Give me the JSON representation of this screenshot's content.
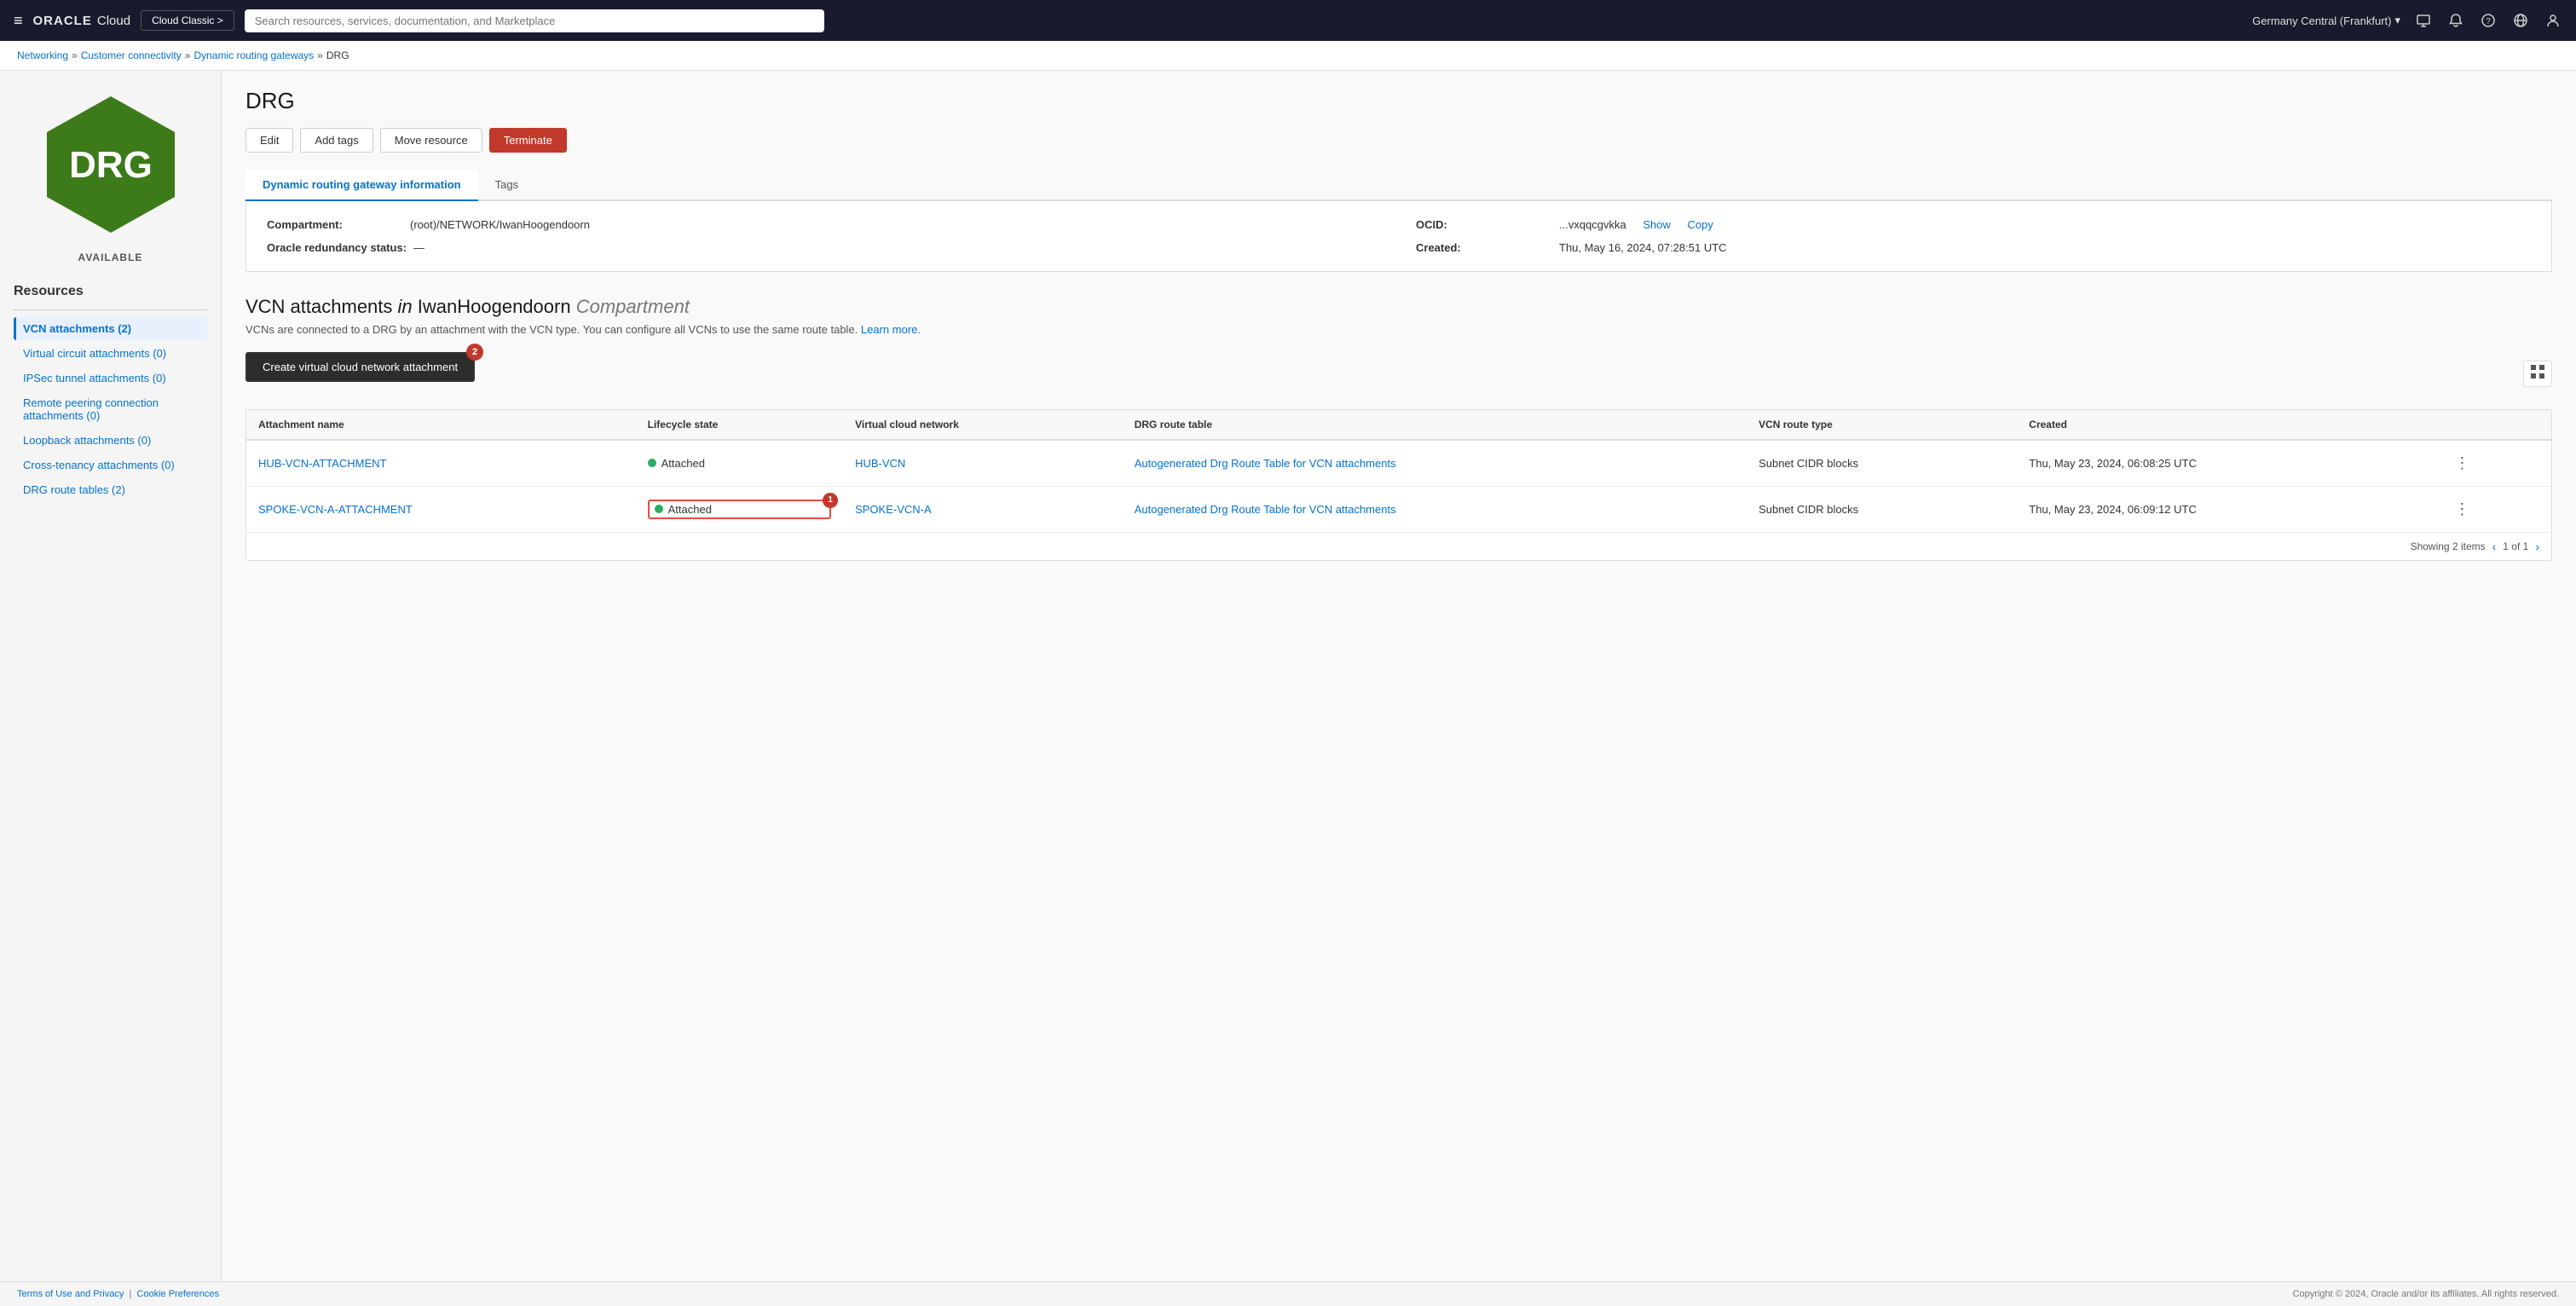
{
  "nav": {
    "hamburger_icon": "≡",
    "brand_oracle": "ORACLE",
    "brand_cloud": "Cloud",
    "classic_btn": "Cloud Classic >",
    "search_placeholder": "Search resources, services, documentation, and Marketplace",
    "region": "Germany Central (Frankfurt)",
    "chevron_down": "▾"
  },
  "breadcrumb": {
    "networking": "Networking",
    "customer_connectivity": "Customer connectivity",
    "dynamic_routing_gateways": "Dynamic routing gateways",
    "current": "DRG"
  },
  "left_panel": {
    "drg_text": "DRG",
    "status_label": "AVAILABLE",
    "resources_heading": "Resources",
    "sidebar_items": [
      {
        "label": "VCN attachments (2)",
        "active": true
      },
      {
        "label": "Virtual circuit attachments (0)",
        "active": false
      },
      {
        "label": "IPSec tunnel attachments (0)",
        "active": false
      },
      {
        "label": "Remote peering connection attachments (0)",
        "active": false
      },
      {
        "label": "Loopback attachments (0)",
        "active": false
      },
      {
        "label": "Cross-tenancy attachments (0)",
        "active": false
      },
      {
        "label": "DRG route tables (2)",
        "active": false
      }
    ]
  },
  "page_title": "DRG",
  "action_buttons": {
    "edit": "Edit",
    "add_tags": "Add tags",
    "move_resource": "Move resource",
    "terminate": "Terminate"
  },
  "tabs": [
    {
      "label": "Dynamic routing gateway information",
      "active": true
    },
    {
      "label": "Tags",
      "active": false
    }
  ],
  "info_panel": {
    "compartment_label": "Compartment:",
    "compartment_value": "(root)/NETWORK/IwanHoogendoorn",
    "ocid_label": "OCID:",
    "ocid_value": "...vxqqcgvkka",
    "ocid_show": "Show",
    "ocid_copy": "Copy",
    "redundancy_label": "Oracle redundancy status:",
    "redundancy_value": "—",
    "created_label": "Created:",
    "created_value": "Thu, May 16, 2024, 07:28:51 UTC"
  },
  "vcn_section": {
    "title_prefix": "VCN attachments ",
    "title_in": "in ",
    "title_compartment": "IwanHoogendoorn",
    "title_suffix": " Compartment",
    "description": "VCNs are connected to a DRG by an attachment with the VCN type. You can configure all VCNs to use the same route table.",
    "learn_more": "Learn more.",
    "create_btn": "Create virtual cloud network attachment",
    "create_badge": "2",
    "table": {
      "columns": [
        "Attachment name",
        "Lifecycle state",
        "Virtual cloud network",
        "DRG route table",
        "VCN route type",
        "Created"
      ],
      "rows": [
        {
          "name": "HUB-VCN-ATTACHMENT",
          "state": "Attached",
          "state_highlighted": false,
          "vcn": "HUB-VCN",
          "drg_route_table": "Autogenerated Drg Route Table for VCN attachments",
          "vcn_route_type": "Subnet CIDR blocks",
          "created": "Thu, May 23, 2024, 06:08:25 UTC"
        },
        {
          "name": "SPOKE-VCN-A-ATTACHMENT",
          "state": "Attached",
          "state_highlighted": true,
          "state_badge": "1",
          "vcn": "SPOKE-VCN-A",
          "drg_route_table": "Autogenerated Drg Route Table for VCN attachments",
          "vcn_route_type": "Subnet CIDR blocks",
          "created": "Thu, May 23, 2024, 06:09:12 UTC"
        }
      ],
      "footer": "Showing 2 items",
      "pagination": "1 of 1"
    }
  },
  "footer": {
    "terms": "Terms of Use and Privacy",
    "cookies": "Cookie Preferences",
    "copyright": "Copyright © 2024, Oracle and/or its affiliates. All rights reserved."
  }
}
